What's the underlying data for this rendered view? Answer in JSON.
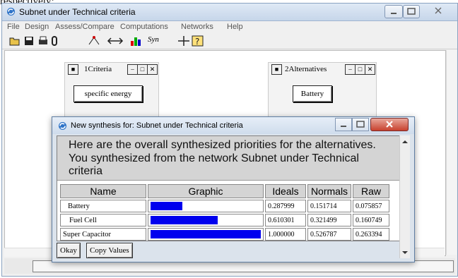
{
  "page": {
    "top_fragment": "respectively:"
  },
  "window": {
    "title": "Subnet under Technical criteria",
    "menu": [
      "File",
      "Design",
      "Assess/Compare",
      "Computations",
      "Networks",
      "Help"
    ],
    "toolbar_icons": [
      "open-icon",
      "save-icon",
      "print-icon",
      "attach-icon",
      "arrow-tool-icon",
      "connect-tool-icon",
      "bar-chart-icon",
      "synthesize-icon",
      "move-tool-icon",
      "help-tool-icon"
    ],
    "toolbar_syn_label": "Syn"
  },
  "clusters": [
    {
      "title": "1Criteria",
      "node": "specific energy"
    },
    {
      "title": "2Alternatives",
      "node": "Battery"
    }
  ],
  "dialog": {
    "title": "New synthesis for: Subnet under Technical criteria",
    "message": "Here are the overall synthesized priorities for the alternatives.  You synthesized from the network Subnet under Technical criteria",
    "columns": [
      "Name",
      "Graphic",
      "Ideals",
      "Normals",
      "Raw"
    ],
    "rows": [
      {
        "name": "Battery",
        "ideal": "0.287999",
        "normal": "0.151714",
        "raw": "0.075857",
        "bar_fraction": 0.287999
      },
      {
        "name": "Fuel Cell",
        "ideal": "0.610301",
        "normal": "0.321499",
        "raw": "0.160749",
        "bar_fraction": 0.610301
      },
      {
        "name": "Super Capacitor",
        "ideal": "1.000000",
        "normal": "0.526787",
        "raw": "0.263394",
        "bar_fraction": 1.0
      }
    ],
    "buttons": {
      "okay": "Okay",
      "copy_values": "Copy Values"
    }
  },
  "colors": {
    "bar": "#0000ee",
    "title_bar": "#c6d6ea",
    "close_button": "#c8412e"
  }
}
